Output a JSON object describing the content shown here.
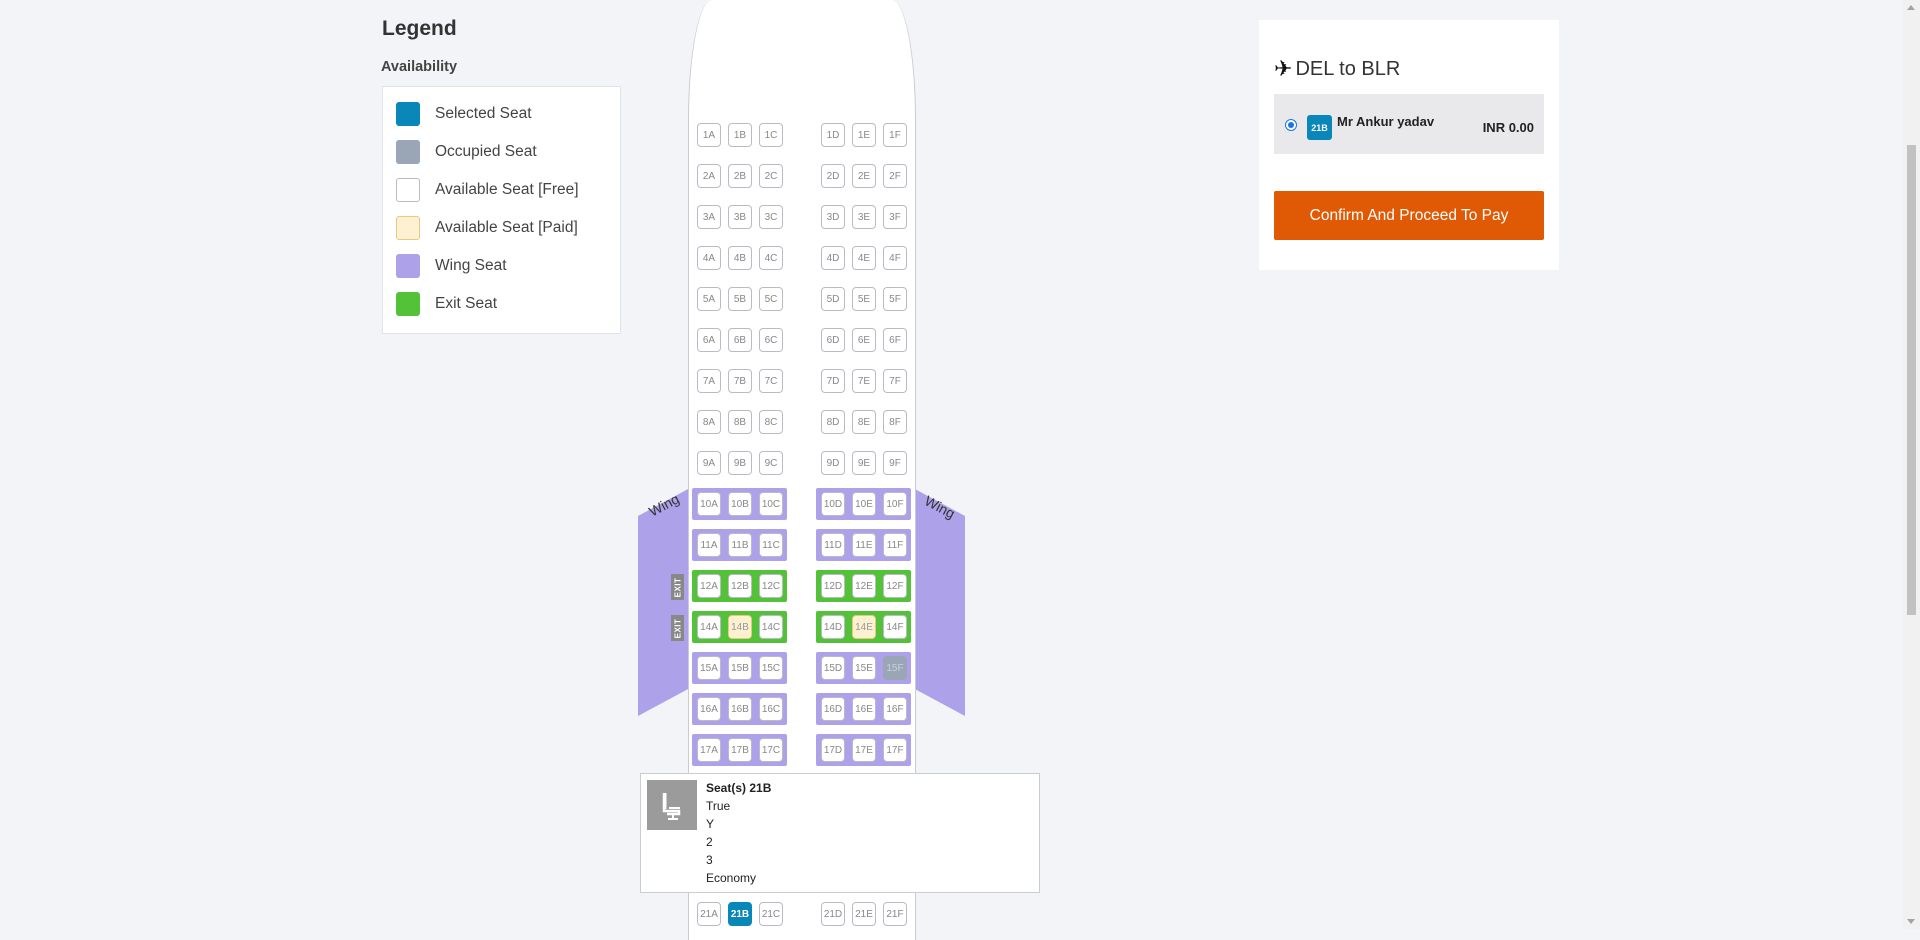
{
  "legend": {
    "title": "Legend",
    "subtitle": "Availability",
    "items": [
      {
        "label": "Selected Seat",
        "color": "#0a87b9",
        "icon": "selected-seat-swatch"
      },
      {
        "label": "Occupied Seat",
        "color": "#9aa5b5",
        "icon": "occupied-seat-swatch"
      },
      {
        "label": "Available Seat [Free]",
        "color": "#ffffff",
        "icon": "free-seat-swatch"
      },
      {
        "label": "Available Seat [Paid]",
        "color": "#fdf1d2",
        "icon": "paid-seat-swatch"
      },
      {
        "label": "Wing Seat",
        "color": "#ada1e9",
        "icon": "wing-seat-swatch"
      },
      {
        "label": "Exit Seat",
        "color": "#54c238",
        "icon": "exit-seat-swatch"
      }
    ]
  },
  "seatmap": {
    "wing_label": "Wing",
    "exit_label": "EXIT",
    "columns_left": [
      "A",
      "B",
      "C"
    ],
    "columns_right": [
      "D",
      "E",
      "F"
    ],
    "rows": [
      "1",
      "2",
      "3",
      "4",
      "5",
      "6",
      "7",
      "8",
      "9",
      "10",
      "11",
      "12",
      "14",
      "15",
      "16",
      "17",
      "21"
    ],
    "wing_rows": [
      "10",
      "11",
      "15",
      "16",
      "17"
    ],
    "exit_rows": [
      "12",
      "14"
    ],
    "paid_seats": [
      "14B",
      "14E"
    ],
    "occupied_seats": [
      "15F"
    ],
    "selected_seats": [
      "21B"
    ]
  },
  "tooltip": {
    "icon": "seat-icon",
    "title": "Seat(s) 21B",
    "lines": [
      "True",
      "Y",
      "2",
      "3",
      "Economy"
    ]
  },
  "booking": {
    "route": "DEL to BLR",
    "route_icon": "airplane-icon",
    "passenger": {
      "seat": "21B",
      "name": "Mr Ankur yadav",
      "price": "INR 0.00"
    },
    "confirm_label": "Confirm And Proceed To Pay"
  },
  "colors": {
    "accent": "#e05a05",
    "selected": "#0a87b9",
    "wing": "#ada1e9",
    "exit": "#54c238"
  }
}
